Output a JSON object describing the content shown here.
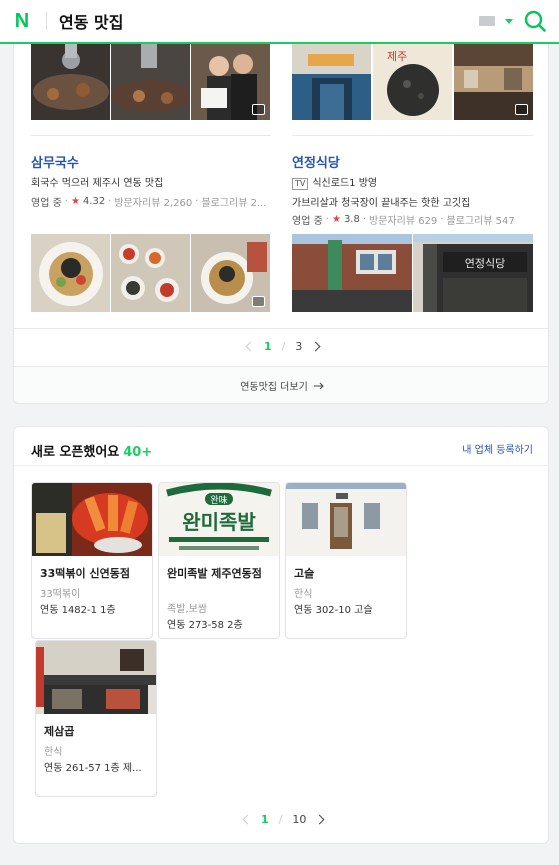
{
  "header": {
    "logo": "N",
    "query": "연동 맛집"
  },
  "places": [
    {
      "name": "삼무국수",
      "tv": "",
      "desc": "회국수 먹으러 제주시 연동 맛집",
      "status": "영업 중",
      "rating": "4.32",
      "visit_reviews": "방문자리뷰 2,260",
      "blog_reviews": "블로그리뷰 2..."
    },
    {
      "name": "연정식당",
      "tv": "TV",
      "desc": "식신로드1 방영",
      "desc2": "가브리살과 청국장이 끝내주는 핫한 고깃집",
      "status": "영업 중",
      "rating": "3.8",
      "visit_reviews": "방문자리뷰 629",
      "blog_reviews": "블로그리뷰 547"
    }
  ],
  "signboard": "연정식당",
  "pager1": {
    "current": "1",
    "sep": "/",
    "total": "3"
  },
  "more": {
    "label": "연동맛집 더보기"
  },
  "new_open": {
    "title": "새로 오픈했어요",
    "count": "40+",
    "register_link": "내 업체 등록하기",
    "items": [
      {
        "name": "33떡볶이 신연동점",
        "category": "33떡볶이",
        "address": "연동 1482-1 1층"
      },
      {
        "name": "완미족발 제주연동점",
        "category": "족발,보쌈",
        "address": "연동 273-58 2층",
        "sign_top": "완味",
        "sign_big": "완미족발"
      },
      {
        "name": "고슬",
        "category": "한식",
        "address": "연동 302-10 고슬"
      },
      {
        "name": "제삼곱",
        "category": "한식",
        "address": "연동 261-57 1층 제..."
      }
    ]
  },
  "pager2": {
    "current": "1",
    "sep": "/",
    "total": "10"
  },
  "colors": {
    "naver_green": "#03c75a",
    "link_blue": "#2755b6",
    "star_red": "#e34545"
  }
}
